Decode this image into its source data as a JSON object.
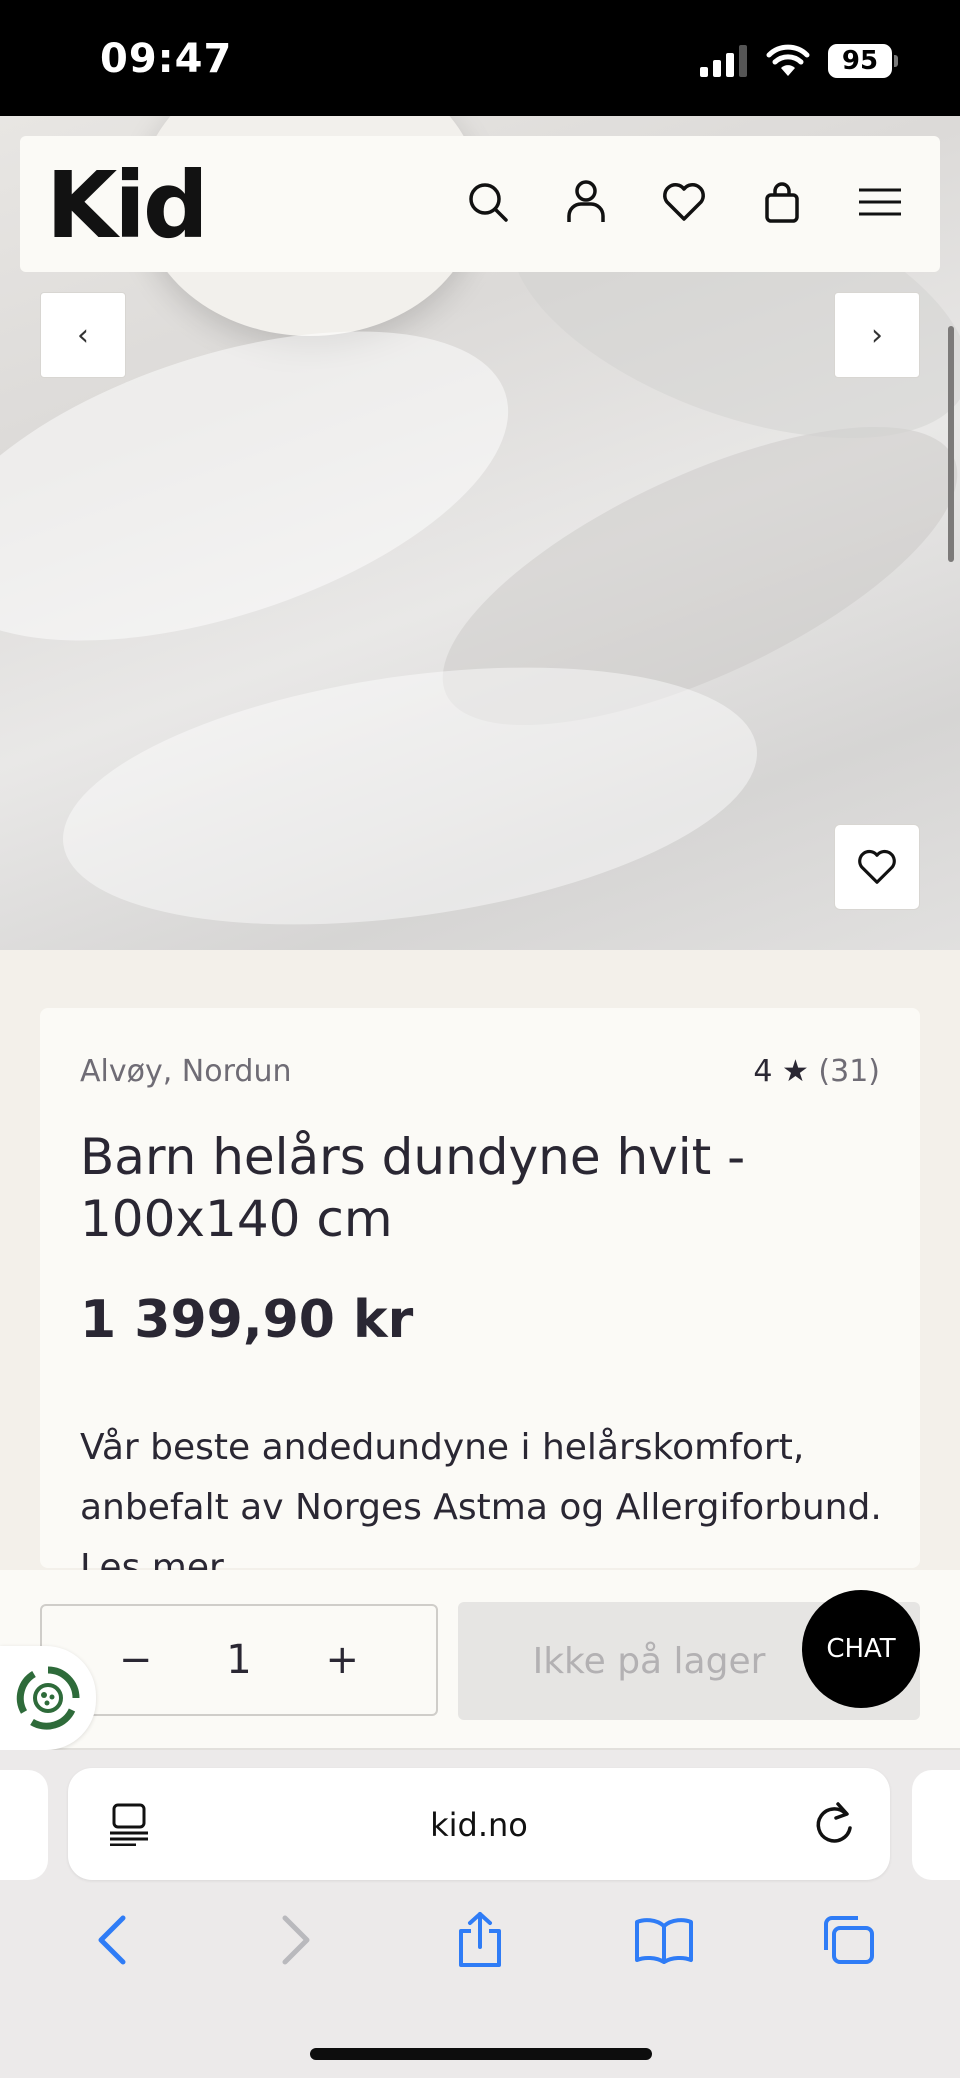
{
  "status_bar": {
    "time": "09:47",
    "battery": "95"
  },
  "header": {
    "logo": "Kid",
    "icons": [
      "search-icon",
      "account-icon",
      "wishlist-icon",
      "cart-icon",
      "menu-icon"
    ]
  },
  "carousel": {
    "prev": "‹",
    "next": "›"
  },
  "product": {
    "brand": "Alvøy, Nordun",
    "rating_value": "4",
    "rating_star": "★",
    "rating_count": "(31)",
    "title": "Barn helårs dundyne hvit - 100x140 cm",
    "price": "1 399,90 kr",
    "description": "Vår beste andedundyne i helårskomfort, anbefalt av Norges Astma og Allergiforbund.",
    "read_more": "Les mer"
  },
  "buy_bar": {
    "qty_minus": "−",
    "quantity": "1",
    "qty_plus": "+",
    "stock_label": "Ikke på lager",
    "chat_label": "CHAT"
  },
  "browser": {
    "url": "kid.no"
  },
  "colors": {
    "accent": "#000000",
    "card": "#fbfaf6",
    "background": "#f3f0ea",
    "browser_blue": "#2f7cf6"
  }
}
